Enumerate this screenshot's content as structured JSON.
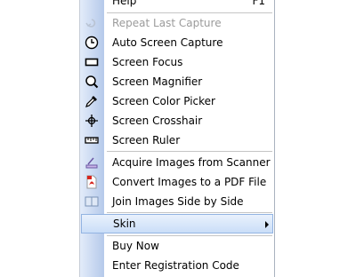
{
  "menu": {
    "help": {
      "label": "Help",
      "shortcut": "F1",
      "icon": "none"
    },
    "repeat_last_capture": {
      "label": "Repeat Last Capture",
      "icon": "repeat-icon",
      "disabled": true
    },
    "auto_screen_capture": {
      "label": "Auto Screen Capture",
      "icon": "clock-icon"
    },
    "screen_focus": {
      "label": "Screen Focus",
      "icon": "focus-rect-icon"
    },
    "screen_magnifier": {
      "label": "Screen Magnifier",
      "icon": "magnifier-icon"
    },
    "screen_color_picker": {
      "label": "Screen Color Picker",
      "icon": "eyedropper-icon"
    },
    "screen_crosshair": {
      "label": "Screen Crosshair",
      "icon": "crosshair-icon"
    },
    "screen_ruler": {
      "label": "Screen Ruler",
      "icon": "ruler-icon"
    },
    "acquire_images": {
      "label": "Acquire Images from Scanner",
      "icon": "scanner-icon"
    },
    "convert_pdf": {
      "label": "Convert Images to a PDF File",
      "icon": "pdf-icon"
    },
    "join_images": {
      "label": "Join Images Side by Side",
      "icon": "join-images-icon"
    },
    "skin": {
      "label": "Skin",
      "icon": "submenu-arrow-icon",
      "selected": true
    },
    "buy_now": {
      "label": "Buy Now"
    },
    "enter_registration": {
      "label": "Enter Registration Code"
    }
  },
  "colors": {
    "highlight_border": "#93b4e2",
    "highlight_fill": "#cadef8",
    "gutter": "#b5c9ea",
    "disabled_text": "#9b9b9b"
  }
}
